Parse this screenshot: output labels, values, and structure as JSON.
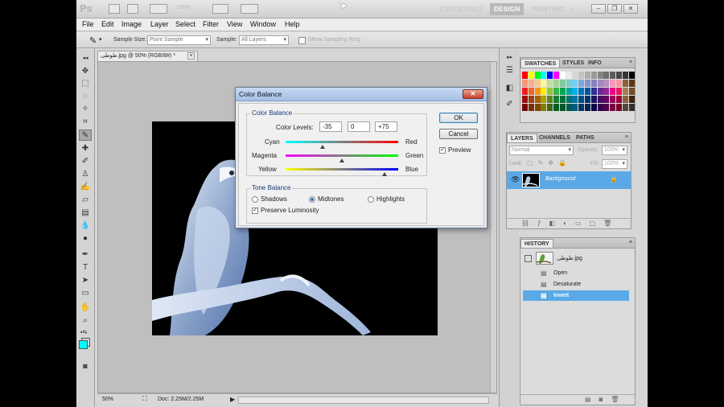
{
  "app": {
    "logo": "Ps",
    "zoom": "100%",
    "workspaces": [
      "ESSENTIALS",
      "DESIGN",
      "PAINTING",
      "»"
    ],
    "active_workspace": "DESIGN"
  },
  "menu": [
    "File",
    "Edit",
    "Image",
    "Layer",
    "Select",
    "Filter",
    "View",
    "Window",
    "Help"
  ],
  "options": {
    "sample_size_label": "Sample Size:",
    "sample_size_value": "Point Sample",
    "sample_label": "Sample:",
    "sample_value": "All Layers",
    "show_ring_label": "Show Sampling Ring"
  },
  "document": {
    "tab_title": "طوطی.jpg @ 50% (RGB/8#) *",
    "zoom": "50%",
    "doc_info": "Doc: 2.25M/2.25M"
  },
  "dialog": {
    "title": "Color Balance",
    "color_balance_group": "Color Balance",
    "color_levels_label": "Color Levels:",
    "levels": [
      "-35",
      "0",
      "+75"
    ],
    "level_values": [
      -35,
      0,
      75
    ],
    "sliders": [
      {
        "left": "Cyan",
        "right": "Red"
      },
      {
        "left": "Magenta",
        "right": "Green"
      },
      {
        "left": "Yellow",
        "right": "Blue"
      }
    ],
    "tone_group": "Tone Balance",
    "tones": [
      "Shadows",
      "Midtones",
      "Highlights"
    ],
    "selected_tone": "Midtones",
    "preserve_luminosity": "Preserve Luminosity",
    "ok": "OK",
    "cancel": "Cancel",
    "preview": "Preview"
  },
  "swatches_panel": {
    "tabs": [
      "SWATCHES",
      "STYLES",
      "INFO"
    ]
  },
  "layers_panel": {
    "tabs": [
      "LAYERS",
      "CHANNELS",
      "PATHS"
    ],
    "blend_mode": "Normal",
    "opacity_label": "Opacity:",
    "opacity_value": "100%",
    "lock_label": "Lock:",
    "fill_label": "Fill:",
    "fill_value": "100%",
    "layer_name": "Background"
  },
  "history_panel": {
    "tab": "HISTORY",
    "snapshot": "طوطی.jpg",
    "steps": [
      "Open",
      "Desaturate",
      "Invert"
    ],
    "selected_step": "Invert"
  },
  "colors": {
    "foreground": "#00ffff",
    "background": "#ffffff",
    "selection": "#5aa9e6"
  }
}
